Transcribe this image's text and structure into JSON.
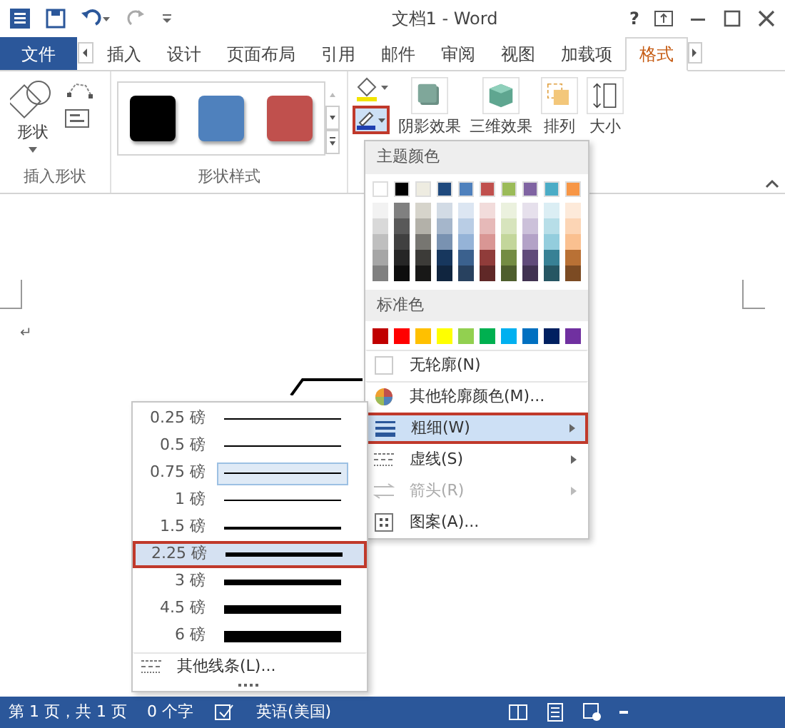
{
  "window": {
    "title": "文档1 - Word",
    "help": "?"
  },
  "tabs": [
    {
      "label": "文件",
      "kind": "file",
      "selected": false
    },
    {
      "label": "插入",
      "kind": "tab",
      "selected": false
    },
    {
      "label": "设计",
      "kind": "tab",
      "selected": false
    },
    {
      "label": "页面布局",
      "kind": "tab",
      "selected": false
    },
    {
      "label": "引用",
      "kind": "tab",
      "selected": false
    },
    {
      "label": "邮件",
      "kind": "tab",
      "selected": false
    },
    {
      "label": "审阅",
      "kind": "tab",
      "selected": false
    },
    {
      "label": "视图",
      "kind": "tab",
      "selected": false
    },
    {
      "label": "加载项",
      "kind": "tab",
      "selected": false
    },
    {
      "label": "格式",
      "kind": "tab",
      "selected": true
    }
  ],
  "ribbon": {
    "insert_shapes": {
      "label": "插入形状",
      "shapes_button": "形状"
    },
    "shape_styles": {
      "label": "形状样式",
      "swatches": [
        {
          "color": "#000000"
        },
        {
          "color": "#4f81bd"
        },
        {
          "color": "#c0504d"
        }
      ]
    },
    "outline_button": {
      "highlighted": true
    },
    "buttons": [
      {
        "label": "阴影效果",
        "kind": "shadow"
      },
      {
        "label": "三维效果",
        "kind": "cube"
      },
      {
        "label": "排列",
        "kind": "arrange"
      },
      {
        "label": "大小",
        "kind": "size"
      }
    ]
  },
  "document": {
    "paragraph_mark": "↵"
  },
  "outline_menu": {
    "theme_heading": "主题颜色",
    "theme_colors": [
      {
        "color": "#ffffff"
      },
      {
        "color": "#000000"
      },
      {
        "color": "#eeece1"
      },
      {
        "color": "#1f497d"
      },
      {
        "color": "#4f81bd"
      },
      {
        "color": "#c0504d"
      },
      {
        "color": "#9bbb59"
      },
      {
        "color": "#8064a2"
      },
      {
        "color": "#4bacc6"
      },
      {
        "color": "#f79646"
      }
    ],
    "standard_heading": "标准色",
    "standard_colors": [
      {
        "color": "#c00000"
      },
      {
        "color": "#ff0000"
      },
      {
        "color": "#ffc000"
      },
      {
        "color": "#ffff00"
      },
      {
        "color": "#92d050"
      },
      {
        "color": "#00b050"
      },
      {
        "color": "#00b0f0"
      },
      {
        "color": "#0070c0"
      },
      {
        "color": "#002060"
      },
      {
        "color": "#7030a0"
      }
    ],
    "items": [
      {
        "label": "无轮廓(N)",
        "kind": "none",
        "highlighted": false,
        "disabled": false,
        "submenu": false
      },
      {
        "label": "其他轮廓颜色(M)...",
        "kind": "wheel",
        "highlighted": false,
        "disabled": false,
        "submenu": false
      },
      {
        "label": "粗细(W)",
        "kind": "weight",
        "highlighted": true,
        "disabled": false,
        "submenu": true
      },
      {
        "label": "虚线(S)",
        "kind": "dash",
        "highlighted": false,
        "disabled": false,
        "submenu": true
      },
      {
        "label": "箭头(R)",
        "kind": "arrow",
        "highlighted": false,
        "disabled": true,
        "submenu": true
      },
      {
        "label": "图案(A)...",
        "kind": "pattern",
        "highlighted": false,
        "disabled": false,
        "submenu": false
      }
    ]
  },
  "weight_menu": {
    "items": [
      {
        "label": "0.25 磅",
        "checked": false,
        "highlighted": false
      },
      {
        "label": "0.5 磅",
        "checked": false,
        "highlighted": false
      },
      {
        "label": "0.75 磅",
        "checked": true,
        "highlighted": false
      },
      {
        "label": "1 磅",
        "checked": false,
        "highlighted": false
      },
      {
        "label": "1.5 磅",
        "checked": false,
        "highlighted": false
      },
      {
        "label": "2.25 磅",
        "checked": false,
        "highlighted": true
      },
      {
        "label": "3 磅",
        "checked": false,
        "highlighted": false
      },
      {
        "label": "4.5 磅",
        "checked": false,
        "highlighted": false
      },
      {
        "label": "6 磅",
        "checked": false,
        "highlighted": false
      }
    ],
    "more": "其他线条(L)..."
  },
  "status_bar": {
    "page": "第 1 页，共 1 页",
    "words": "0 个字",
    "language": "英语(美国)"
  }
}
